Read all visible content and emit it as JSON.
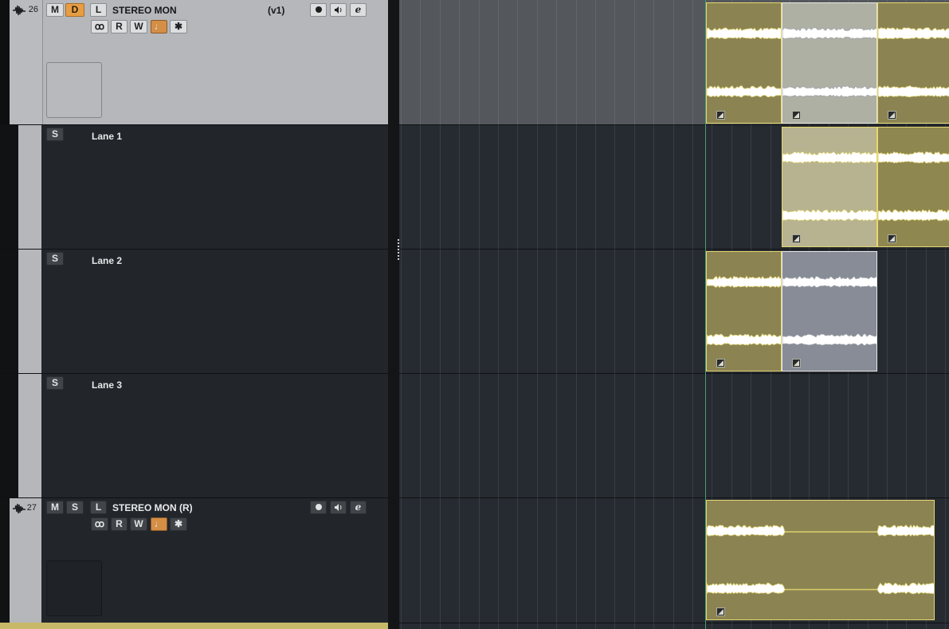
{
  "tracks": [
    {
      "number": "26",
      "name": "STEREO MON",
      "version": "(v1)",
      "buttons": {
        "mute": "M",
        "second": "D",
        "latch": "L",
        "read": "R",
        "write": "W",
        "link": "ꝏ",
        "music": "♩",
        "freeze": "✱",
        "edit": "e"
      }
    },
    {
      "number": "27",
      "name": "STEREO MON (R)",
      "version": "",
      "buttons": {
        "mute": "M",
        "second": "S",
        "latch": "L",
        "read": "R",
        "write": "W",
        "link": "ꝏ",
        "music": "♩",
        "freeze": "✱",
        "edit": "e"
      }
    }
  ],
  "lanes": [
    {
      "solo": "S",
      "name": "Lane 1"
    },
    {
      "solo": "S",
      "name": "Lane 2"
    },
    {
      "solo": "S",
      "name": "Lane 3"
    }
  ],
  "colors": {
    "track_header_bg": "#b5b7ba",
    "lane_bg": "#22262b",
    "event_yellow": "#8b8352",
    "event_border": "#e5d770",
    "event_selected": "#878c96",
    "arm_orange": "#e79d44",
    "folder_bar": "#c8b969"
  },
  "icons": {
    "track_type": "waveform-icon",
    "record": "record-icon",
    "monitor": "speaker-icon",
    "edit": "edit-channel-icon",
    "fade": "fade-handle-icon"
  }
}
